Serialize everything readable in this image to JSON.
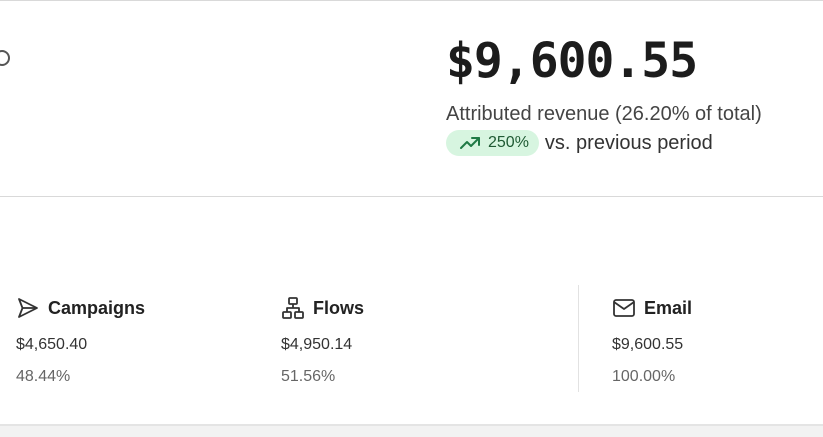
{
  "summary": {
    "amount": "$9,600.55",
    "caption": "Attributed revenue (26.20% of total)",
    "trend": {
      "value": "250%",
      "suffix": "vs. previous period",
      "icon": "trending-up-icon",
      "color": "#1f7a45"
    }
  },
  "channels": [
    {
      "title": "Campaigns",
      "icon": "send-icon",
      "amount": "$4,650.40",
      "percent": "48.44%"
    },
    {
      "title": "Flows",
      "icon": "flow-hierarchy-icon",
      "amount": "$4,950.14",
      "percent": "51.56%"
    },
    {
      "title": "Email",
      "icon": "mail-icon",
      "amount": "$9,600.55",
      "percent": "100.00%"
    }
  ]
}
